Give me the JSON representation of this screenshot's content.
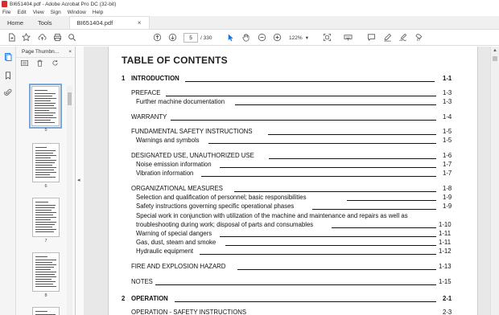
{
  "window": {
    "title": "BI651404.pdf - Adobe Acrobat Pro DC (32-bit)"
  },
  "menu": [
    "File",
    "Edit",
    "View",
    "Sign",
    "Window",
    "Help"
  ],
  "tabs": {
    "home": "Home",
    "tools": "Tools",
    "doc": "BI651404.pdf",
    "doc_close": "×"
  },
  "toolbar": {
    "page_current": "5",
    "page_total": "/ 330",
    "zoom": "122%",
    "zoom_arrow": "▾"
  },
  "thumbnails": {
    "header": "Page Thumbn...",
    "close": "×",
    "pages": [
      "5",
      "6",
      "7",
      "8"
    ]
  },
  "toc": {
    "heading": "TABLE OF CONTENTS",
    "entries": [
      {
        "num": "1",
        "text": "INTRODUCTION",
        "page": "1-1",
        "level": 0
      },
      {
        "text": "PREFACE",
        "page": "1-3",
        "level": 1
      },
      {
        "text": "Further machine documentation",
        "page": "1-3",
        "level": 2
      },
      {
        "text": "WARRANTY",
        "page": "1-4",
        "level": 1
      },
      {
        "text": "FUNDAMENTAL SAFETY INSTRUCTIONS",
        "page": "1-5",
        "level": 1
      },
      {
        "text": "Warnings and symbols",
        "page": "1-5",
        "level": 2
      },
      {
        "text": "DESIGNATED USE, UNAUTHORIZED USE",
        "page": "1-6",
        "level": 1
      },
      {
        "text": "Noise emission information",
        "page": "1-7",
        "level": 2
      },
      {
        "text": "Vibration information",
        "page": "1-7",
        "level": 2
      },
      {
        "text": "ORGANIZATIONAL MEASURES",
        "page": "1-8",
        "level": 1
      },
      {
        "text": "Selection and qualification of personnel; basic responsibilities",
        "page": "1-9",
        "level": 2
      },
      {
        "text": "Safety instructions governing specific operational phases",
        "page": "1-9",
        "level": 2
      },
      {
        "text": "Special work in conjunction with utilization of the machine and maintenance and repairs as well as",
        "text2": "troubleshooting during work; disposal of parts and consumables",
        "page": "1-10",
        "level": 2
      },
      {
        "text": "Warning of special dangers",
        "page": "1-11",
        "level": 2
      },
      {
        "text": "Gas, dust, steam and smoke",
        "page": "1-11",
        "level": 2
      },
      {
        "text": "Hydraulic equipment",
        "page": "1-12",
        "level": 2
      },
      {
        "text": "FIRE AND EXPLOSION HAZARD",
        "page": "1-13",
        "level": 1
      },
      {
        "text": "NOTES",
        "page": "1-15",
        "level": 1
      },
      {
        "num": "2",
        "text": "OPERATION",
        "page": "2-1",
        "level": 0
      },
      {
        "text": "OPERATION - SAFETY INSTRUCTIONS",
        "page": "2-3",
        "level": 1
      }
    ]
  },
  "colors": {
    "accent": "#1473e6",
    "selection": "#7aa7d8",
    "app_icon": "#d32f2f"
  }
}
